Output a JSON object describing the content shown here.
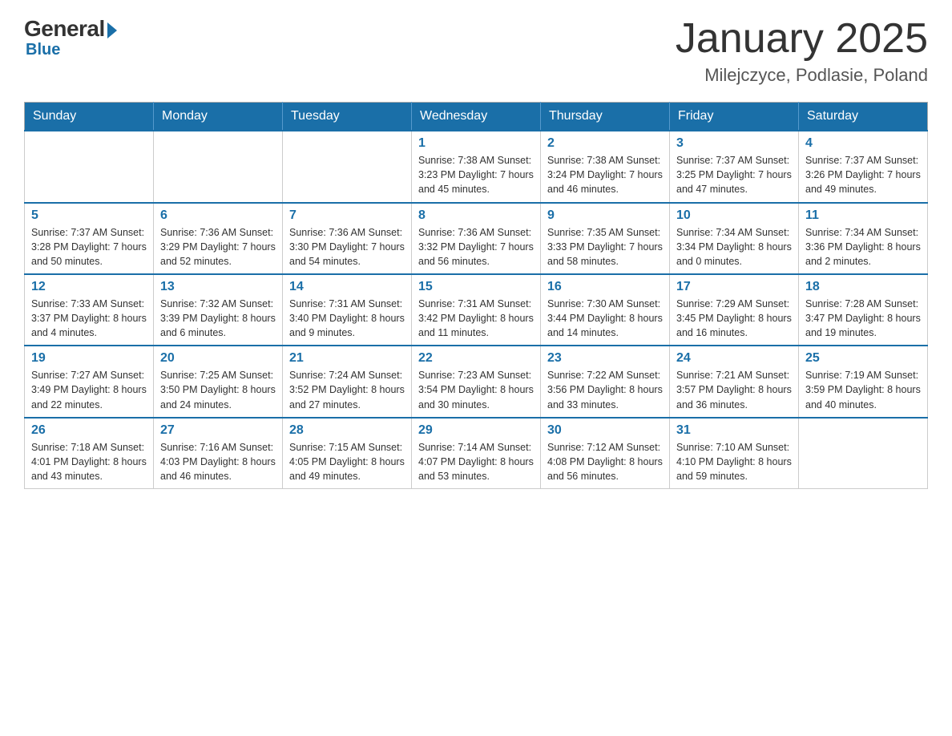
{
  "logo": {
    "general": "General",
    "blue": "Blue",
    "arrow": "▶"
  },
  "title": "January 2025",
  "location": "Milejczyce, Podlasie, Poland",
  "days_of_week": [
    "Sunday",
    "Monday",
    "Tuesday",
    "Wednesday",
    "Thursday",
    "Friday",
    "Saturday"
  ],
  "weeks": [
    [
      {
        "day": "",
        "info": ""
      },
      {
        "day": "",
        "info": ""
      },
      {
        "day": "",
        "info": ""
      },
      {
        "day": "1",
        "info": "Sunrise: 7:38 AM\nSunset: 3:23 PM\nDaylight: 7 hours\nand 45 minutes."
      },
      {
        "day": "2",
        "info": "Sunrise: 7:38 AM\nSunset: 3:24 PM\nDaylight: 7 hours\nand 46 minutes."
      },
      {
        "day": "3",
        "info": "Sunrise: 7:37 AM\nSunset: 3:25 PM\nDaylight: 7 hours\nand 47 minutes."
      },
      {
        "day": "4",
        "info": "Sunrise: 7:37 AM\nSunset: 3:26 PM\nDaylight: 7 hours\nand 49 minutes."
      }
    ],
    [
      {
        "day": "5",
        "info": "Sunrise: 7:37 AM\nSunset: 3:28 PM\nDaylight: 7 hours\nand 50 minutes."
      },
      {
        "day": "6",
        "info": "Sunrise: 7:36 AM\nSunset: 3:29 PM\nDaylight: 7 hours\nand 52 minutes."
      },
      {
        "day": "7",
        "info": "Sunrise: 7:36 AM\nSunset: 3:30 PM\nDaylight: 7 hours\nand 54 minutes."
      },
      {
        "day": "8",
        "info": "Sunrise: 7:36 AM\nSunset: 3:32 PM\nDaylight: 7 hours\nand 56 minutes."
      },
      {
        "day": "9",
        "info": "Sunrise: 7:35 AM\nSunset: 3:33 PM\nDaylight: 7 hours\nand 58 minutes."
      },
      {
        "day": "10",
        "info": "Sunrise: 7:34 AM\nSunset: 3:34 PM\nDaylight: 8 hours\nand 0 minutes."
      },
      {
        "day": "11",
        "info": "Sunrise: 7:34 AM\nSunset: 3:36 PM\nDaylight: 8 hours\nand 2 minutes."
      }
    ],
    [
      {
        "day": "12",
        "info": "Sunrise: 7:33 AM\nSunset: 3:37 PM\nDaylight: 8 hours\nand 4 minutes."
      },
      {
        "day": "13",
        "info": "Sunrise: 7:32 AM\nSunset: 3:39 PM\nDaylight: 8 hours\nand 6 minutes."
      },
      {
        "day": "14",
        "info": "Sunrise: 7:31 AM\nSunset: 3:40 PM\nDaylight: 8 hours\nand 9 minutes."
      },
      {
        "day": "15",
        "info": "Sunrise: 7:31 AM\nSunset: 3:42 PM\nDaylight: 8 hours\nand 11 minutes."
      },
      {
        "day": "16",
        "info": "Sunrise: 7:30 AM\nSunset: 3:44 PM\nDaylight: 8 hours\nand 14 minutes."
      },
      {
        "day": "17",
        "info": "Sunrise: 7:29 AM\nSunset: 3:45 PM\nDaylight: 8 hours\nand 16 minutes."
      },
      {
        "day": "18",
        "info": "Sunrise: 7:28 AM\nSunset: 3:47 PM\nDaylight: 8 hours\nand 19 minutes."
      }
    ],
    [
      {
        "day": "19",
        "info": "Sunrise: 7:27 AM\nSunset: 3:49 PM\nDaylight: 8 hours\nand 22 minutes."
      },
      {
        "day": "20",
        "info": "Sunrise: 7:25 AM\nSunset: 3:50 PM\nDaylight: 8 hours\nand 24 minutes."
      },
      {
        "day": "21",
        "info": "Sunrise: 7:24 AM\nSunset: 3:52 PM\nDaylight: 8 hours\nand 27 minutes."
      },
      {
        "day": "22",
        "info": "Sunrise: 7:23 AM\nSunset: 3:54 PM\nDaylight: 8 hours\nand 30 minutes."
      },
      {
        "day": "23",
        "info": "Sunrise: 7:22 AM\nSunset: 3:56 PM\nDaylight: 8 hours\nand 33 minutes."
      },
      {
        "day": "24",
        "info": "Sunrise: 7:21 AM\nSunset: 3:57 PM\nDaylight: 8 hours\nand 36 minutes."
      },
      {
        "day": "25",
        "info": "Sunrise: 7:19 AM\nSunset: 3:59 PM\nDaylight: 8 hours\nand 40 minutes."
      }
    ],
    [
      {
        "day": "26",
        "info": "Sunrise: 7:18 AM\nSunset: 4:01 PM\nDaylight: 8 hours\nand 43 minutes."
      },
      {
        "day": "27",
        "info": "Sunrise: 7:16 AM\nSunset: 4:03 PM\nDaylight: 8 hours\nand 46 minutes."
      },
      {
        "day": "28",
        "info": "Sunrise: 7:15 AM\nSunset: 4:05 PM\nDaylight: 8 hours\nand 49 minutes."
      },
      {
        "day": "29",
        "info": "Sunrise: 7:14 AM\nSunset: 4:07 PM\nDaylight: 8 hours\nand 53 minutes."
      },
      {
        "day": "30",
        "info": "Sunrise: 7:12 AM\nSunset: 4:08 PM\nDaylight: 8 hours\nand 56 minutes."
      },
      {
        "day": "31",
        "info": "Sunrise: 7:10 AM\nSunset: 4:10 PM\nDaylight: 8 hours\nand 59 minutes."
      },
      {
        "day": "",
        "info": ""
      }
    ]
  ]
}
